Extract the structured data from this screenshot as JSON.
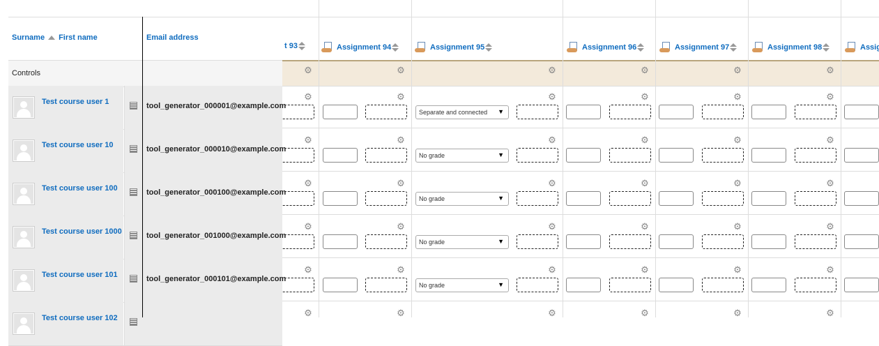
{
  "header": {
    "surname_label": "Surname",
    "firstname_label": "First name",
    "email_label": "Email address",
    "controls_label": "Controls"
  },
  "columns": [
    {
      "label": "t 93",
      "type": "partial"
    },
    {
      "label": "",
      "type": "blank"
    },
    {
      "label": "Assignment 94",
      "type": "assignment"
    },
    {
      "label": "Assignment 95",
      "type": "assignment"
    },
    {
      "label": "Assignment 96",
      "type": "assignment"
    },
    {
      "label": "Assignment 97",
      "type": "assignment"
    },
    {
      "label": "Assignment 98",
      "type": "assignment"
    },
    {
      "label": "Assig",
      "type": "assignment"
    }
  ],
  "users": [
    {
      "name": "Test course user 1",
      "email": "tool_generator_000001@example.com",
      "grade_select": "Separate and connected"
    },
    {
      "name": "Test course user 10",
      "email": "tool_generator_000010@example.com",
      "grade_select": "No grade"
    },
    {
      "name": "Test course user 100",
      "email": "tool_generator_000100@example.com",
      "grade_select": "No grade"
    },
    {
      "name": "Test course user 1000",
      "email": "tool_generator_001000@example.com",
      "grade_select": "No grade"
    },
    {
      "name": "Test course user 101",
      "email": "tool_generator_000101@example.com",
      "grade_select": "No grade"
    },
    {
      "name": "Test course user 102",
      "email": "",
      "grade_select": ""
    }
  ],
  "icons": {
    "gear": "gear-icon",
    "assignment": "assignment-icon",
    "report": "user-report-icon",
    "sort": "sort-icon"
  },
  "colors": {
    "link": "#0f6cbf",
    "controls_band": "#f3eadb",
    "frozen_bg": "#ebebeb"
  }
}
